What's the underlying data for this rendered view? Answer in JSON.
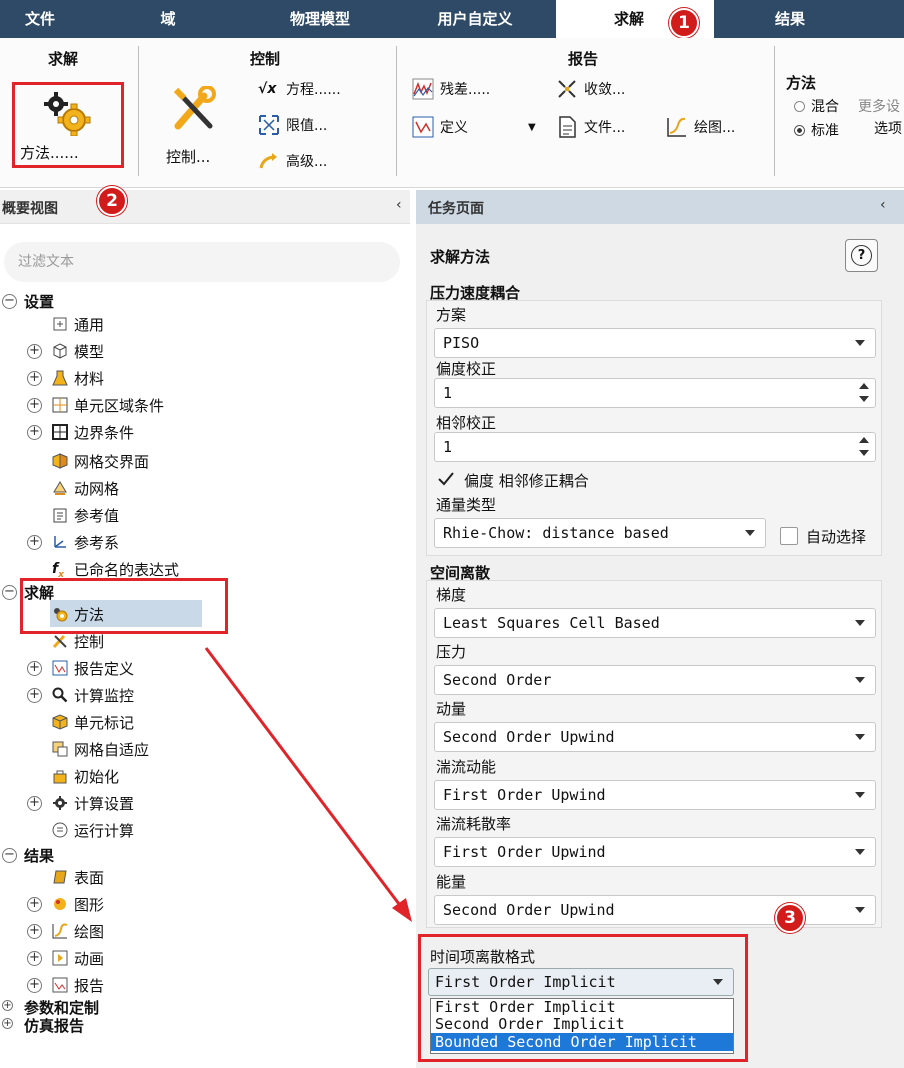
{
  "menu": {
    "tabs": [
      "文件",
      "域",
      "物理模型",
      "用户自定义",
      "求解",
      "结果"
    ],
    "active_tab": "求解"
  },
  "ribbon": {
    "group_solve": {
      "title": "求解",
      "method_label": "方法......"
    },
    "group_control": {
      "title": "控制",
      "control_label": "控制...",
      "equations_label": "方程......",
      "limits_label": "限值...",
      "advanced_label": "高级..."
    },
    "group_report": {
      "title": "报告",
      "residuals_label": "残差.....",
      "convergence_label": "收敛...",
      "definition_label": "定义",
      "files_label": "文件...",
      "plots_label": "绘图..."
    },
    "group_method": {
      "title": "方法",
      "option_mixed": "混合",
      "option_standard": "标准",
      "more_settings": "更多设",
      "options": "选项",
      "selected": "标准"
    }
  },
  "outline": {
    "title": "概要视图",
    "filter_placeholder": "过滤文本",
    "setup": {
      "label": "设置",
      "items": [
        "通用",
        "模型",
        "材料",
        "单元区域条件",
        "边界条件",
        "网格交界面",
        "动网格",
        "参考值",
        "参考系",
        "已命名的表达式"
      ]
    },
    "solution": {
      "label": "求解",
      "items": [
        "方法",
        "控制",
        "报告定义",
        "计算监控",
        "单元标记",
        "网格自适应",
        "初始化",
        "计算设置",
        "运行计算"
      ]
    },
    "results": {
      "label": "结果",
      "items": [
        "表面",
        "图形",
        "绘图",
        "动画",
        "报告"
      ]
    },
    "parameters": {
      "label": "参数和定制"
    },
    "sim_report": {
      "label": "仿真报告"
    }
  },
  "task_page": {
    "title": "任务页面",
    "heading": "求解方法",
    "help_icon": "?",
    "pv_coupling": {
      "section": "压力速度耦合",
      "scheme_label": "方案",
      "scheme_value": "PISO",
      "skewness_label": "偏度校正",
      "skewness_value": "1",
      "neighbor_label": "相邻校正",
      "neighbor_value": "1",
      "coupling_checkbox": "偏度 相邻修正耦合",
      "flux_label": "通量类型",
      "flux_value": "Rhie-Chow: distance based",
      "auto_select": "自动选择"
    },
    "spatial": {
      "section": "空间离散",
      "gradient_label": "梯度",
      "gradient_value": "Least Squares Cell Based",
      "pressure_label": "压力",
      "pressure_value": "Second Order",
      "momentum_label": "动量",
      "momentum_value": "Second Order Upwind",
      "tke_label": "湍流动能",
      "tke_value": "First Order Upwind",
      "tdr_label": "湍流耗散率",
      "tdr_value": "First Order Upwind",
      "energy_label": "能量",
      "energy_value": "Second Order Upwind"
    },
    "transient": {
      "label": "时间项离散格式",
      "value": "First Order Implicit",
      "options": [
        "First Order Implicit",
        "Second Order Implicit",
        "Bounded Second Order Implicit"
      ],
      "highlighted_option": "Bounded Second Order Implicit"
    }
  },
  "annotations": {
    "badge1": "1",
    "badge2": "2",
    "badge3": "3"
  },
  "colors": {
    "menubar": "#2f4a66",
    "highlight": "#1e78d7",
    "annotation_red": "#e0242a",
    "selected_tree": "#c9d9e8"
  }
}
